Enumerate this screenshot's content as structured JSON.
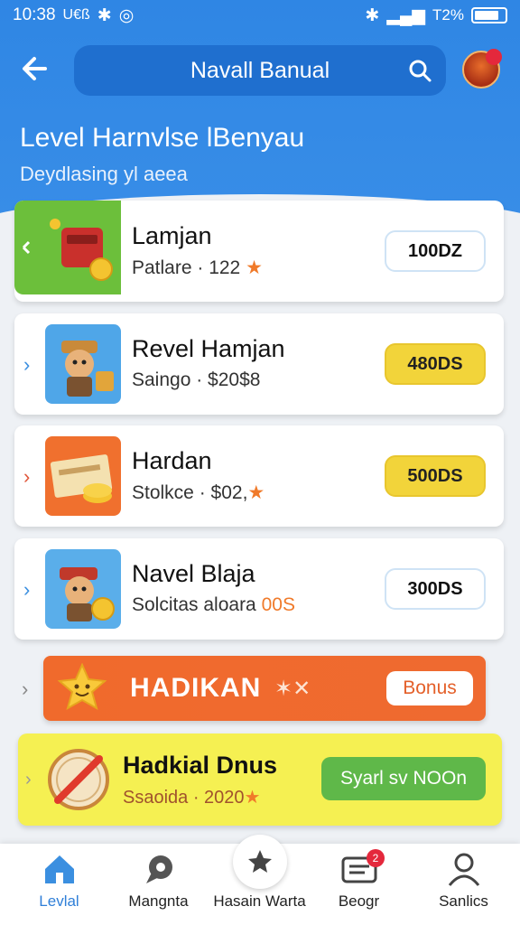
{
  "status": {
    "time": "10:38",
    "left_text": "U€ß",
    "battery_text": "T2%"
  },
  "header": {
    "search_label": "Navall Banual",
    "avatar_badge": ""
  },
  "page": {
    "title": "Level Harnvlse lBenyau",
    "subtitle": "Deydlasing yl aeea"
  },
  "items": [
    {
      "name": "Lamjan",
      "meta": "Patlare · 122",
      "meta_star": "★",
      "price": "100DZ",
      "price_style": "outline"
    },
    {
      "name": "Revel Hamjan",
      "meta": "Saingo · $20$8",
      "meta_star": "",
      "price": "480DS",
      "price_style": "yellow"
    },
    {
      "name": "Hardan",
      "meta": "Stolkce · $02,",
      "meta_star": "★",
      "price": "500DS",
      "price_style": "yellow"
    },
    {
      "name": "Navel Blaja",
      "meta": "Solcitas aloara",
      "meta_star": "00S",
      "price": "300DS",
      "price_style": "outline"
    }
  ],
  "banner": {
    "title": "HADIKAN",
    "marks": "✶✕",
    "bonus": "Bonus"
  },
  "promo": {
    "name": "Hadkial Dnus",
    "meta": "Ssaoida · 2020",
    "meta_star": "★",
    "button": "Syarl sv NOOn"
  },
  "nav": [
    {
      "label": "Levlal",
      "icon": "home-icon",
      "active": true
    },
    {
      "label": "Mangnta",
      "icon": "chat-icon",
      "active": false
    },
    {
      "label": "Hasain Warta",
      "icon": "star-icon",
      "active": false
    },
    {
      "label": "Beogr",
      "icon": "message-icon",
      "active": false,
      "badge": "2"
    },
    {
      "label": "Sanlics",
      "icon": "profile-icon",
      "active": false
    }
  ],
  "colors": {
    "primary": "#2f86e4",
    "accent_orange": "#f06a2c",
    "accent_yellow": "#f2d43a",
    "accent_green": "#5fb849"
  }
}
